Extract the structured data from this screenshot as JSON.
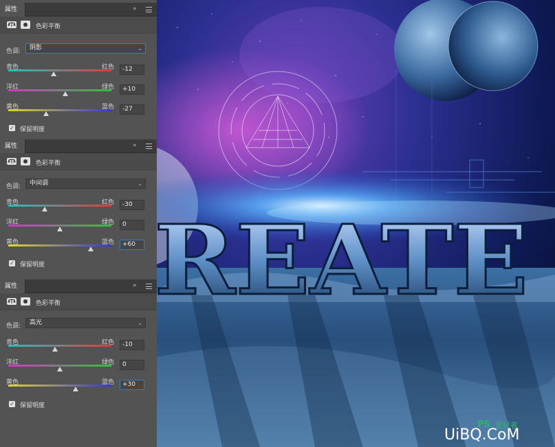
{
  "panels": [
    {
      "tab": "属性",
      "subtitle": "色彩平衡",
      "tone_label": "色调:",
      "tone_value": "阴影",
      "sliders": [
        {
          "left": "青色",
          "right": "红色",
          "value": "-12",
          "level": -12
        },
        {
          "left": "洋红",
          "right": "绿色",
          "value": "+10",
          "level": 10
        },
        {
          "left": "黄色",
          "right": "蓝色",
          "value": "-27",
          "level": -27
        }
      ],
      "preserve": "保留明度"
    },
    {
      "tab": "属性",
      "subtitle": "色彩平衡",
      "tone_label": "色调:",
      "tone_value": "中间调",
      "sliders": [
        {
          "left": "青色",
          "right": "红色",
          "value": "-30",
          "level": -30
        },
        {
          "left": "洋红",
          "right": "绿色",
          "value": "0",
          "level": 0
        },
        {
          "left": "黄色",
          "right": "蓝色",
          "value": "+60",
          "level": 60
        }
      ],
      "preserve": "保留明度"
    },
    {
      "tab": "属性",
      "subtitle": "色彩平衡",
      "tone_label": "色调:",
      "tone_value": "高光",
      "sliders": [
        {
          "left": "青色",
          "right": "红色",
          "value": "-10",
          "level": -10
        },
        {
          "left": "洋红",
          "right": "绿色",
          "value": "0",
          "level": 0
        },
        {
          "left": "黄色",
          "right": "蓝色",
          "value": "+30",
          "level": 30
        }
      ],
      "preserve": "保留明度"
    }
  ],
  "icons": {
    "collapse": "»",
    "dropdown": "⌄",
    "check": "✓"
  },
  "canvas": {
    "headline": "REATE"
  },
  "watermark": {
    "ps": "PS",
    "sub": "爱好者",
    "site": "UiBQ.CoM"
  }
}
